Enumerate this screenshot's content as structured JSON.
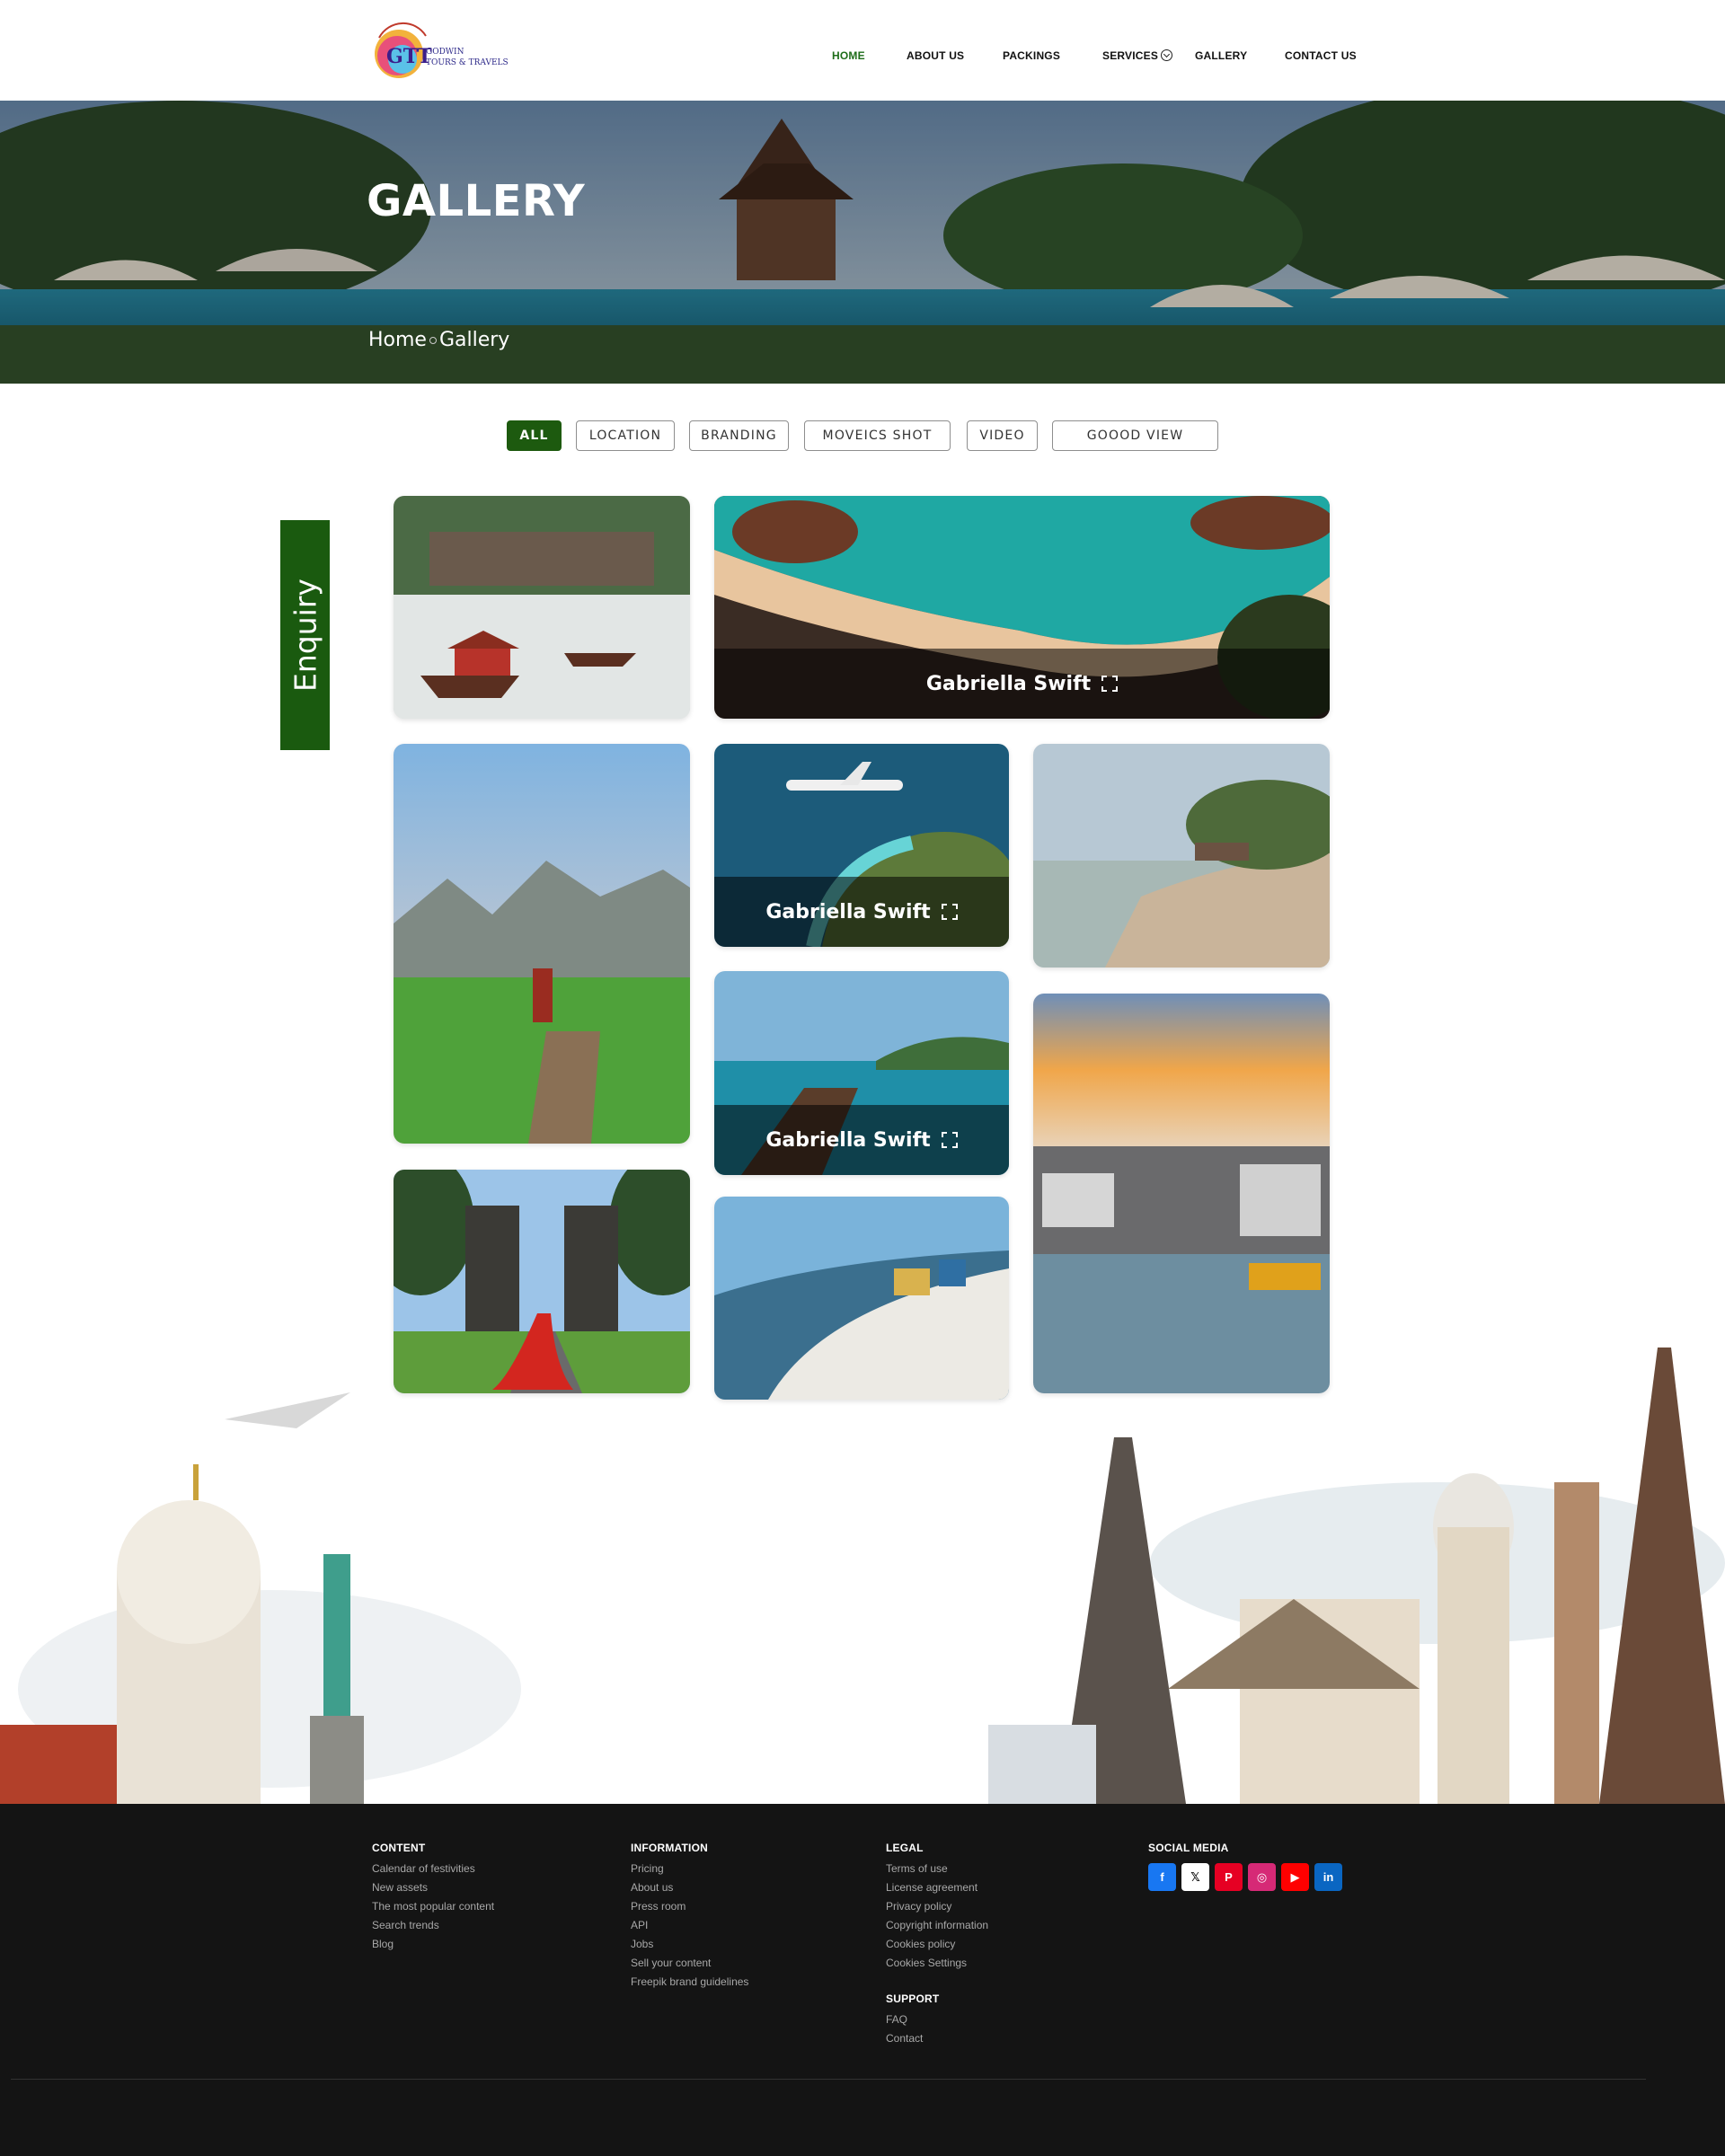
{
  "header": {
    "logo_text": "GTT",
    "logo_brand": "GODWIN TOURS & TRAVELS",
    "nav": [
      {
        "label": "HOME",
        "active": true
      },
      {
        "label": "ABOUT US"
      },
      {
        "label": "PACKINGS"
      },
      {
        "label": "SERVICES",
        "icon": "chevron-down-icon"
      },
      {
        "label": "GALLERY"
      },
      {
        "label": "CONTACT US"
      }
    ]
  },
  "hero": {
    "title": "GALLERY",
    "breadcrumb": [
      "Home",
      "Gallery"
    ]
  },
  "filters": [
    {
      "label": "ALL",
      "active": true
    },
    {
      "label": "LOCATION"
    },
    {
      "label": "BRANDING"
    },
    {
      "label": "MOVEICS SHOT"
    },
    {
      "label": "VIDEO"
    },
    {
      "label": "GOOOD VIEW"
    }
  ],
  "enquiry": {
    "label": "Enquiry"
  },
  "gallery": {
    "tiles": [
      {
        "subject": "misty river boat village",
        "caption": ""
      },
      {
        "subject": "aerial turquoise beach",
        "caption": "Gabriella Swift"
      },
      {
        "subject": "woman on boardwalk rice field",
        "caption": ""
      },
      {
        "subject": "airplane over coastline",
        "caption": "Gabriella Swift"
      },
      {
        "subject": "tropical beach with palms",
        "caption": ""
      },
      {
        "subject": "wooden pier tropical sea",
        "caption": "Gabriella Swift"
      },
      {
        "subject": "water town canal at sunset",
        "caption": ""
      },
      {
        "subject": "woman in red dress at temple gate",
        "caption": ""
      },
      {
        "subject": "white village on cliff",
        "caption": ""
      }
    ]
  },
  "footer": {
    "content": {
      "heading": "CONTENT",
      "links": [
        "Calendar of festivities",
        "New assets",
        "The most popular content",
        "Search trends",
        "Blog"
      ]
    },
    "information": {
      "heading": "INFORMATION",
      "links": [
        "Pricing",
        "About us",
        "Press room",
        "API",
        "Jobs",
        "Sell your content",
        "Freepik brand guidelines"
      ]
    },
    "legal": {
      "heading": "LEGAL",
      "links": [
        "Terms of use",
        "License agreement",
        "Privacy policy",
        "Copyright information",
        "Cookies policy",
        "Cookies Settings"
      ]
    },
    "support": {
      "heading": "SUPPORT",
      "links": [
        "FAQ",
        "Contact"
      ]
    },
    "social": {
      "heading": "SOCIAL MEDIA",
      "icons": [
        {
          "name": "facebook-icon",
          "glyph": "f",
          "color": "#1877f2"
        },
        {
          "name": "x-icon",
          "glyph": "𝕏",
          "color": "#ffffff"
        },
        {
          "name": "pinterest-icon",
          "glyph": "P",
          "color": "#e60023"
        },
        {
          "name": "instagram-icon",
          "glyph": "◎",
          "color": "#d62976"
        },
        {
          "name": "youtube-icon",
          "glyph": "▶",
          "color": "#ff0000"
        },
        {
          "name": "linkedin-icon",
          "glyph": "in",
          "color": "#0a66c2"
        }
      ]
    }
  }
}
